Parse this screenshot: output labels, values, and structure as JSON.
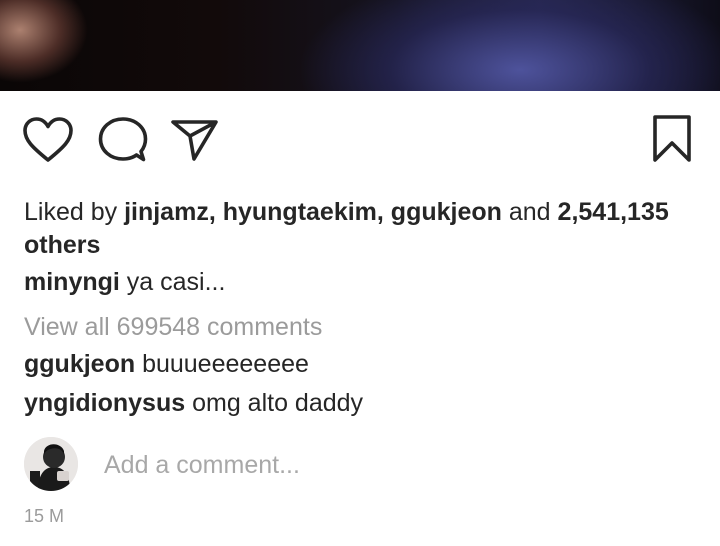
{
  "post": {
    "image_alt": "post photo",
    "actions": {
      "like_icon": "heart-icon",
      "comment_icon": "comment-bubble-icon",
      "share_icon": "paper-plane-icon",
      "save_icon": "bookmark-icon"
    },
    "likes": {
      "prefix": "Liked by",
      "users": "jinjamz, hyungtaekim, ggukjeon",
      "conjunction": "and",
      "others": "2,541,135 others"
    },
    "caption": {
      "username": "minyngi",
      "text": "ya casi..."
    },
    "view_all_comments": "View all 699548 comments",
    "comments": [
      {
        "username": "ggukjeon",
        "text": "buuueeeeeeee"
      },
      {
        "username": "yngidionysus",
        "text": "omg alto daddy"
      }
    ],
    "add_comment_placeholder": "Add a comment...",
    "timestamp": "15 M"
  }
}
